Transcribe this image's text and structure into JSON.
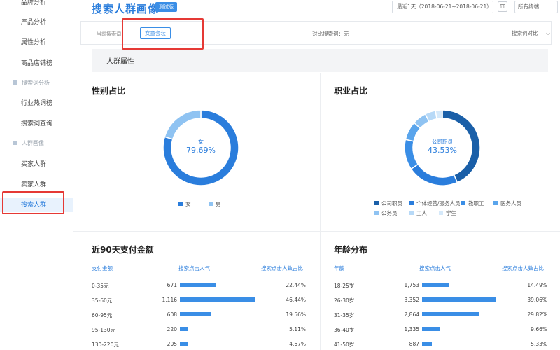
{
  "sidebar": {
    "items_top": [
      "品牌分析",
      "产品分析",
      "属性分析",
      "商品店铺榜"
    ],
    "group_search": "搜索词分析",
    "items_search": [
      "行业热词榜",
      "搜索词查询"
    ],
    "group_crowd": "人群画像",
    "items_crowd": [
      "买家人群",
      "卖家人群",
      "搜索人群"
    ],
    "active": "搜索人群"
  },
  "header": {
    "title": "搜索人群画像",
    "beta": "测试版",
    "date_range": "最近1天（2018-06-21~2018-06-21）",
    "terminal": "所有终端"
  },
  "filter": {
    "current_label": "当前搜索词：",
    "current_tag": "女童套装",
    "compare_label": "对比搜索词：无",
    "compare_button": "搜索词对比"
  },
  "section": {
    "title": "人群属性"
  },
  "gender": {
    "title": "性别占比",
    "center_label": "女",
    "center_value": "79.69%",
    "legend": [
      {
        "name": "女",
        "color": "#2a7ddc"
      },
      {
        "name": "男",
        "color": "#8fc3f2"
      }
    ]
  },
  "occupation": {
    "title": "职业占比",
    "center_label": "公司职员",
    "center_value": "43.53%",
    "legend": [
      {
        "name": "公司职员",
        "color": "#1a5fa8"
      },
      {
        "name": "个体经营/服务人员",
        "color": "#2a7ddc"
      },
      {
        "name": "教职工",
        "color": "#3a8ee6"
      },
      {
        "name": "医务人员",
        "color": "#5aa5ec"
      },
      {
        "name": "公务员",
        "color": "#8fc3f2"
      },
      {
        "name": "工人",
        "color": "#b7d9f7"
      },
      {
        "name": "学生",
        "color": "#d5e9fa"
      }
    ]
  },
  "pay": {
    "title": "近90天支付金额",
    "col1": "支付金额",
    "col2": "搜索点击人气",
    "col3": "搜索点击人数占比",
    "rows": [
      {
        "range": "0-35元",
        "popularity": "671",
        "share": "22.44%",
        "pct": 22.44
      },
      {
        "range": "35-60元",
        "popularity": "1,116",
        "share": "46.44%",
        "pct": 46.44
      },
      {
        "range": "60-95元",
        "popularity": "608",
        "share": "19.56%",
        "pct": 19.56
      },
      {
        "range": "95-130元",
        "popularity": "220",
        "share": "5.11%",
        "pct": 5.11
      },
      {
        "range": "130-220元",
        "popularity": "205",
        "share": "4.67%",
        "pct": 4.67
      }
    ]
  },
  "age": {
    "title": "年龄分布",
    "col1": "年龄",
    "col2": "搜索点击人气",
    "col3": "搜索点击人数占比",
    "rows": [
      {
        "range": "18-25岁",
        "popularity": "1,753",
        "share": "14.49%",
        "pct": 14.49
      },
      {
        "range": "26-30岁",
        "popularity": "3,352",
        "share": "39.06%",
        "pct": 39.06
      },
      {
        "range": "31-35岁",
        "popularity": "2,864",
        "share": "29.82%",
        "pct": 29.82
      },
      {
        "range": "36-40岁",
        "popularity": "1,335",
        "share": "9.66%",
        "pct": 9.66
      },
      {
        "range": "41-50岁",
        "popularity": "887",
        "share": "5.33%",
        "pct": 5.33
      }
    ]
  },
  "chart_data": [
    {
      "type": "pie",
      "title": "性别占比",
      "categories": [
        "女",
        "男"
      ],
      "values": [
        79.69,
        20.31
      ]
    },
    {
      "type": "pie",
      "title": "职业占比",
      "categories": [
        "公司职员",
        "个体经营/服务人员",
        "教职工",
        "医务人员",
        "公务员",
        "工人",
        "学生"
      ],
      "values": [
        43.53,
        22,
        13,
        8,
        6,
        4.5,
        2.97
      ]
    }
  ]
}
